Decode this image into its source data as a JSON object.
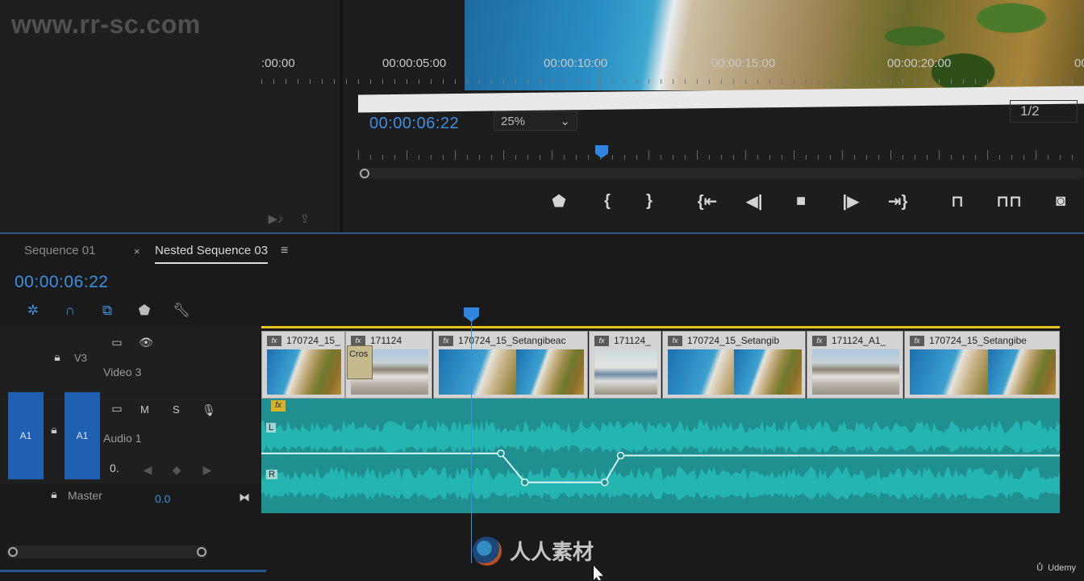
{
  "watermark": {
    "url": "www.rr-sc.com",
    "logo_text": "人人素材"
  },
  "program_monitor": {
    "timecode": "00:00:06:22",
    "zoom": "25%",
    "resolution": "1/2",
    "transport": [
      {
        "name": "add-marker-button",
        "icon": "marker-icon",
        "glyph": "⬟"
      },
      {
        "name": "mark-in-button",
        "icon": "mark-in-icon",
        "glyph": "{"
      },
      {
        "name": "mark-out-button",
        "icon": "mark-out-icon",
        "glyph": "}"
      },
      {
        "name": "go-to-in-button",
        "icon": "go-to-in-icon",
        "glyph": "{⇤"
      },
      {
        "name": "step-back-button",
        "icon": "step-back-icon",
        "glyph": "◀|"
      },
      {
        "name": "stop-button",
        "icon": "stop-icon",
        "glyph": "■"
      },
      {
        "name": "step-forward-button",
        "icon": "step-forward-icon",
        "glyph": "|▶"
      },
      {
        "name": "go-to-out-button",
        "icon": "go-to-out-icon",
        "glyph": "⇥}"
      },
      {
        "name": "lift-button",
        "icon": "lift-icon",
        "glyph": "⊓"
      },
      {
        "name": "extract-button",
        "icon": "extract-icon",
        "glyph": "⊓⊓"
      },
      {
        "name": "export-frame-button",
        "icon": "camera-icon",
        "glyph": "◙"
      }
    ]
  },
  "timeline": {
    "tabs": [
      {
        "label": "Sequence 01"
      },
      {
        "label": "Nested Sequence 03"
      }
    ],
    "close_glyph": "×",
    "menu_glyph": "≡",
    "timecode": "00:00:06:22",
    "ruler_labels": [
      ":00:00",
      "00:00:05:00",
      "00:00:10:00",
      "00:00:15:00",
      "00:00:20:00",
      "00"
    ],
    "tracks": {
      "v3": {
        "id": "V3",
        "name": "Video 3"
      },
      "a1": {
        "id": "A1",
        "name": "Audio 1",
        "patch": "A1",
        "mute": "M",
        "solo": "S",
        "value": "0."
      },
      "master": {
        "name": "Master",
        "value": "0.0"
      }
    },
    "clips": [
      {
        "label": "170724_15_"
      },
      {
        "label": "171124"
      },
      {
        "label": "170724_15_Setangibeac"
      },
      {
        "label": "171124_"
      },
      {
        "label": "170724_15_Setangib"
      },
      {
        "label": "171124_A1_"
      },
      {
        "label": "170724_15_Setangibe"
      }
    ],
    "transition_label": "Cros",
    "fx_label": "fx",
    "channels": {
      "left": "L",
      "right": "R"
    },
    "keyframes": [
      {
        "t": 0.0,
        "level": 0.5
      },
      {
        "t": 0.3,
        "level": 0.5
      },
      {
        "t": 0.33,
        "level": 0.22
      },
      {
        "t": 0.43,
        "level": 0.22
      },
      {
        "t": 0.45,
        "level": 0.48
      },
      {
        "t": 1.0,
        "level": 0.48
      }
    ]
  },
  "udemy_label": "Udemy"
}
